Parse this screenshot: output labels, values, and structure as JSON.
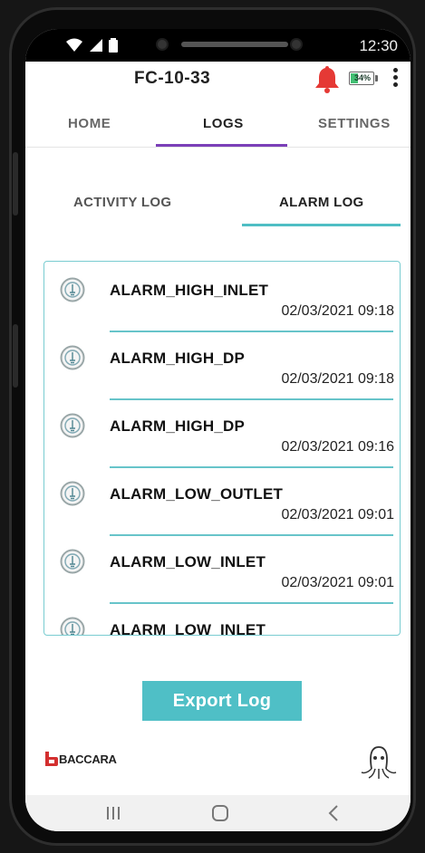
{
  "status_bar": {
    "time": "12:30",
    "icons": [
      "wifi-icon",
      "signal-icon",
      "battery-icon"
    ]
  },
  "app_bar": {
    "device_id": "FC-10-33",
    "battery_percent": "34%",
    "battery_level": 0.34,
    "alarm_color": "#e53935"
  },
  "tabs": [
    {
      "label": "HOME",
      "active": false
    },
    {
      "label": "LOGS",
      "active": true
    },
    {
      "label": "SETTINGS",
      "active": false
    }
  ],
  "sub_tabs": [
    {
      "label": "ACTIVITY LOG",
      "active": false
    },
    {
      "label": "ALARM LOG",
      "active": true
    }
  ],
  "alarm_log": [
    {
      "name": "ALARM_HIGH_INLET",
      "timestamp": "02/03/2021 09:18"
    },
    {
      "name": "ALARM_HIGH_DP",
      "timestamp": "02/03/2021 09:18"
    },
    {
      "name": "ALARM_HIGH_DP",
      "timestamp": "02/03/2021 09:16"
    },
    {
      "name": "ALARM_LOW_OUTLET",
      "timestamp": "02/03/2021 09:01"
    },
    {
      "name": "ALARM_LOW_INLET",
      "timestamp": "02/03/2021 09:01"
    },
    {
      "name": "ALARM_LOW_INLET",
      "timestamp": ""
    }
  ],
  "export_button": {
    "label": "Export Log"
  },
  "branding": {
    "logo_text": "BACCARA",
    "logo_color": "#d32f2f"
  },
  "colors": {
    "accent_purple": "#7b3fb8",
    "accent_teal": "#4fbec4"
  }
}
